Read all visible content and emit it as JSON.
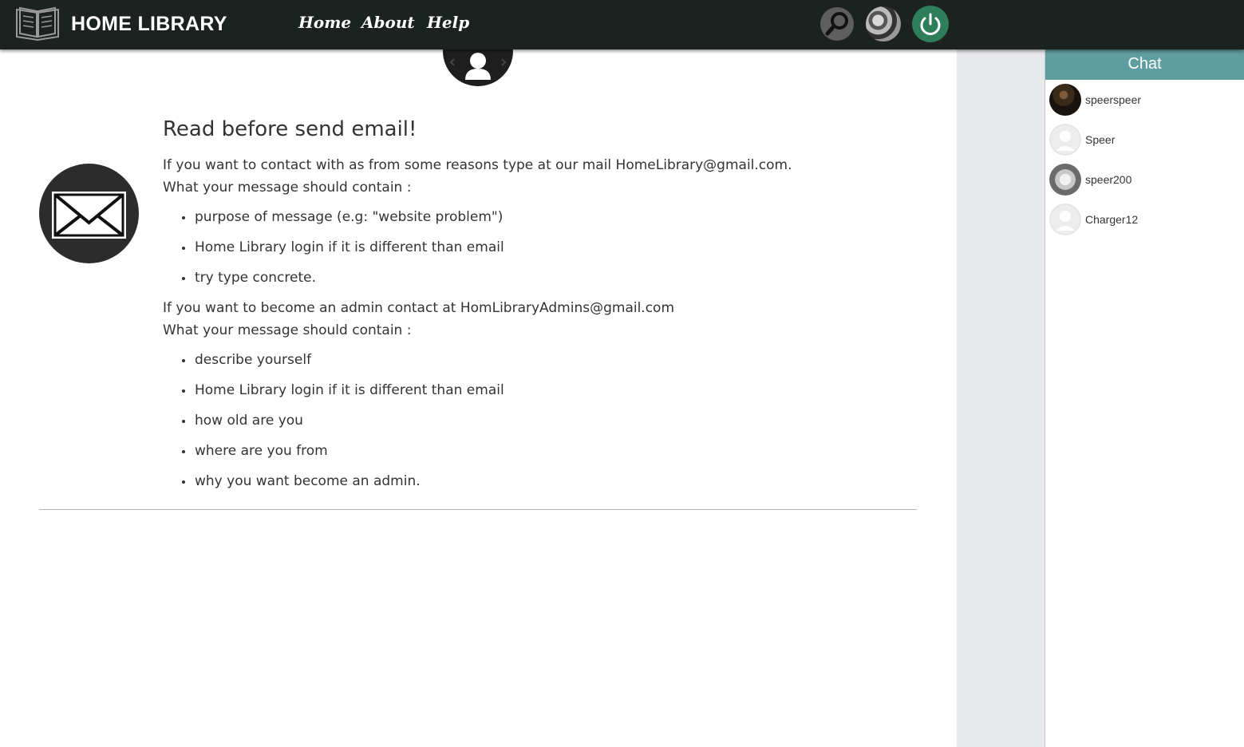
{
  "header": {
    "brand": "HOME LIBRARY",
    "nav": [
      {
        "label": "Home"
      },
      {
        "label": "About"
      },
      {
        "label": "Help"
      }
    ],
    "icons": {
      "logo": "open-book-icon",
      "search": "search-icon",
      "avatar": "user-avatar",
      "power": "power-icon"
    },
    "colors": {
      "bar": "#1b2220",
      "power_button": "#2e7d5b",
      "search_button": "#5e5e5e"
    }
  },
  "content": {
    "title": "Read before send email!",
    "intro_line1": "If you want to contact with as from some reasons type at our mail HomeLibrary@gmail.com.",
    "intro_line2": "What your message should contain :",
    "contact_items": [
      "purpose of message (e.g: \"website problem\")",
      "Home Library login if it is different than email",
      "try type concrete."
    ],
    "admin_line1": "If you want to become an admin contact at HomLibraryAdmins@gmail.com",
    "admin_line2": "What your message should contain :",
    "admin_items": [
      "describe yourself",
      "Home Library login if it is different than email",
      "how old are you",
      "where are you from",
      "why you want become an admin."
    ]
  },
  "chat": {
    "header": "Chat",
    "header_color": "#5f9ea0",
    "users": [
      {
        "name": "speerspeer",
        "avatar": "photo-dark"
      },
      {
        "name": "Speer",
        "avatar": "default-user"
      },
      {
        "name": "speer200",
        "avatar": "photo-cat"
      },
      {
        "name": "Charger12",
        "avatar": "default-user"
      }
    ]
  }
}
